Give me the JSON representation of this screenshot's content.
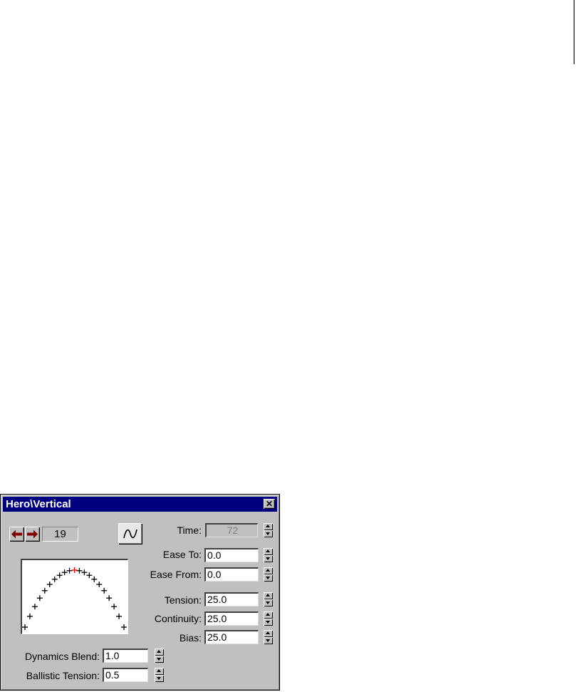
{
  "window": {
    "title": "Hero\\Vertical",
    "close_label": "✕"
  },
  "frame": {
    "value": "19"
  },
  "icons": {
    "prev": "left-arrow-icon",
    "next": "right-arrow-icon",
    "curve": "curve-shape-icon",
    "close": "close-icon"
  },
  "fields": {
    "time": {
      "label": "Time:",
      "value": "72"
    },
    "ease_to": {
      "label": "Ease To:",
      "value": "0.0"
    },
    "ease_from": {
      "label": "Ease From:",
      "value": "0.0"
    },
    "tension": {
      "label": "Tension:",
      "value": "25.0"
    },
    "continuity": {
      "label": "Continuity:",
      "value": "25.0"
    },
    "bias": {
      "label": "Bias:",
      "value": "25.0"
    },
    "dynamics_blend": {
      "label": "Dynamics Blend:",
      "value": "1.0"
    },
    "ballistic_tension": {
      "label": "Ballistic Tension:",
      "value": "0.5"
    }
  },
  "graph": {
    "marker_color": "#000000",
    "selected_color": "#ff0000"
  },
  "colors": {
    "titlebar": "#00007f",
    "arrow": "#800000",
    "face": "#c0c0c0"
  }
}
